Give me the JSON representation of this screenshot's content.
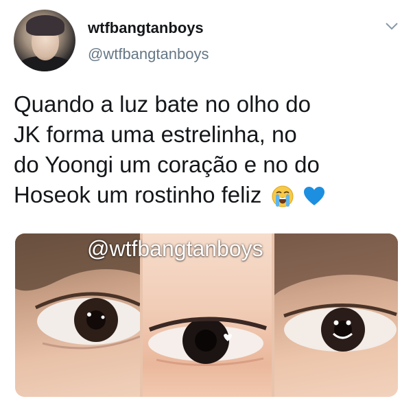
{
  "tweet": {
    "display_name": "wtfbangtanboys",
    "handle": "@wtfbangtanboys",
    "menu_icon": "chevron-down-icon",
    "text_lines": [
      "Quando a luz bate no olho do",
      "JK forma uma estrelinha, no",
      "do Yoongi um coração e no do",
      "Hoseok um rostinho feliz"
    ],
    "emojis": [
      "loudly-crying-face-icon",
      "blue-heart-icon"
    ],
    "media": {
      "watermark": "@wtfbangtanboys",
      "panels": [
        "eye-photo-jk",
        "eye-photo-yoongi",
        "eye-photo-hoseok"
      ]
    }
  },
  "colors": {
    "text": "#14171a",
    "handle": "#657786",
    "heart": "#1d8fe0",
    "emoji_face": "#f7c948"
  }
}
